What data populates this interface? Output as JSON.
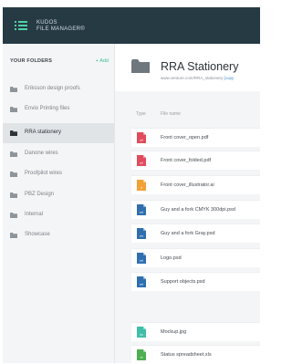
{
  "app": {
    "title_line1": "KUDOS",
    "title_line2": "FILE MANAGER®"
  },
  "sidebar": {
    "title": "YOUR FOLDERS",
    "add_label": "+ Add",
    "items": [
      {
        "label": "Eriksson design proofs",
        "active": false
      },
      {
        "label": "Envio Printing files",
        "active": false
      },
      {
        "label": "RRA stationery",
        "active": true
      },
      {
        "label": "Danone wires",
        "active": false
      },
      {
        "label": "Proofpilot wires",
        "active": false
      },
      {
        "label": "PBZ Design",
        "active": false
      },
      {
        "label": "Internal",
        "active": false
      },
      {
        "label": "Showcase",
        "active": false
      }
    ]
  },
  "main": {
    "folder_name": "RRA Stationery",
    "folder_url": "www.venture.com/RRA_stationery",
    "copy_link_label": "[copy",
    "columns": {
      "type": "Type",
      "name": "File name"
    },
    "files": [
      {
        "name": "Front cover_open.pdf",
        "icon": "pdf-icon",
        "color": "#e04c5c"
      },
      {
        "name": "Front cover_folded.pdf",
        "icon": "pdf-icon",
        "color": "#e04c5c"
      },
      {
        "name": "Front cover_illustrator.ai",
        "icon": "ai-icon",
        "color": "#f2a134"
      },
      {
        "name": "Guy and a fork CMYK 300dpi.psd",
        "icon": "psd-icon",
        "color": "#2f6fb0"
      },
      {
        "name": "Guy and a fork Gray.psd",
        "icon": "psd-icon",
        "color": "#2f6fb0"
      },
      {
        "name": "Logo.psd",
        "icon": "psd-icon",
        "color": "#2f6fb0"
      },
      {
        "name": "Support objects.psd",
        "icon": "psd-icon",
        "color": "#2f6fb0"
      },
      {
        "name": "Mockup.jpg",
        "icon": "jpg-icon",
        "color": "#3fbfa8"
      },
      {
        "name": "Status spreadsheet.xls",
        "icon": "xls-icon",
        "color": "#4caf50"
      }
    ]
  },
  "colors": {
    "topbar": "#263a44",
    "accent": "#3dbf91",
    "sidebar_bg": "#f4f5f6",
    "active_item": "#e1e4e7"
  }
}
